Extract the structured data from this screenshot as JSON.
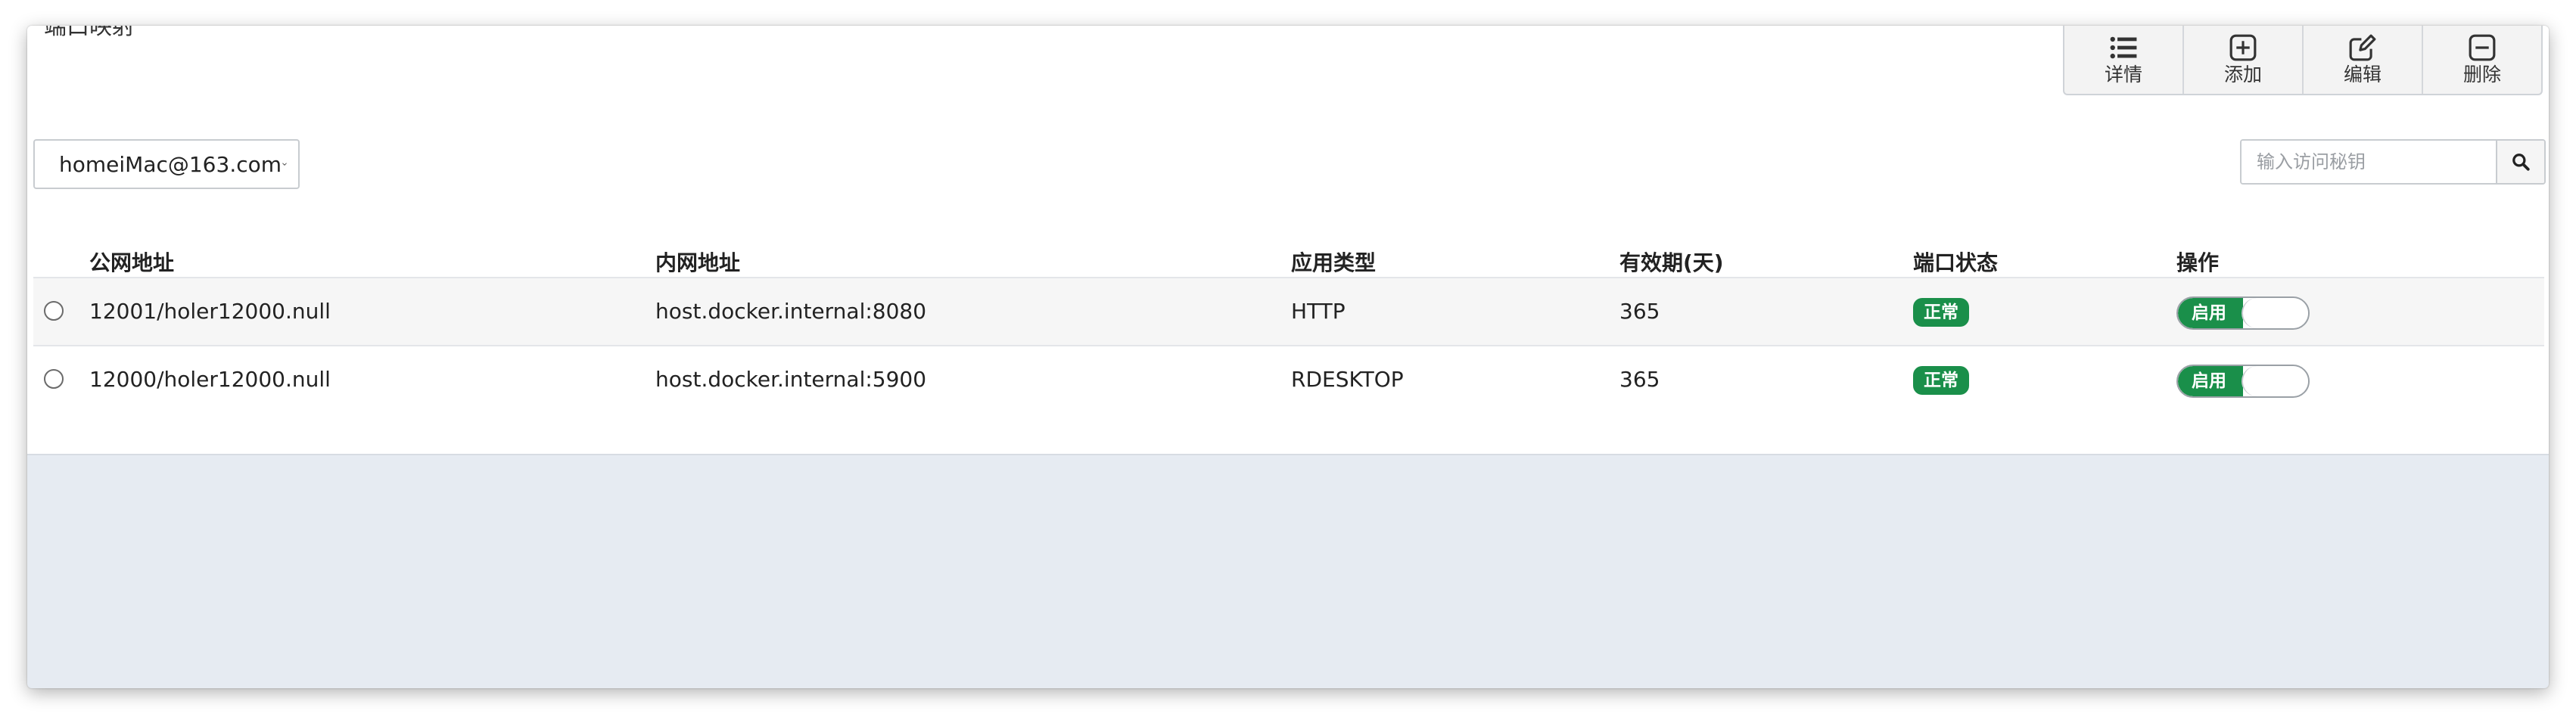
{
  "panel": {
    "title": "端口映射"
  },
  "toolbar": {
    "details_label": "详情",
    "add_label": "添加",
    "edit_label": "编辑",
    "delete_label": "删除"
  },
  "account_select": {
    "value": "homeiMac@163.com"
  },
  "search": {
    "placeholder": "输入访问秘钥",
    "value": ""
  },
  "table": {
    "headers": {
      "public_address": "公网地址",
      "internal_address": "内网地址",
      "app_type": "应用类型",
      "validity_days": "有效期(天)",
      "port_status": "端口状态",
      "action": "操作"
    },
    "rows": [
      {
        "public_address": "12001/holer12000.null",
        "internal_address": "host.docker.internal:8080",
        "app_type": "HTTP",
        "validity_days": "365",
        "port_status": "正常",
        "toggle_label": "启用"
      },
      {
        "public_address": "12000/holer12000.null",
        "internal_address": "host.docker.internal:5900",
        "app_type": "RDESKTOP",
        "validity_days": "365",
        "port_status": "正常",
        "toggle_label": "启用"
      }
    ]
  },
  "colors": {
    "status_green": "#1a8f4a",
    "content_background": "#e6ebf2",
    "row_alt_background": "#f6f6f6"
  },
  "icons": {
    "details": "list-icon",
    "add": "plus-square-icon",
    "edit": "pencil-square-icon",
    "delete": "minus-square-icon",
    "search": "search-icon",
    "select": "chevron-down-icon"
  }
}
